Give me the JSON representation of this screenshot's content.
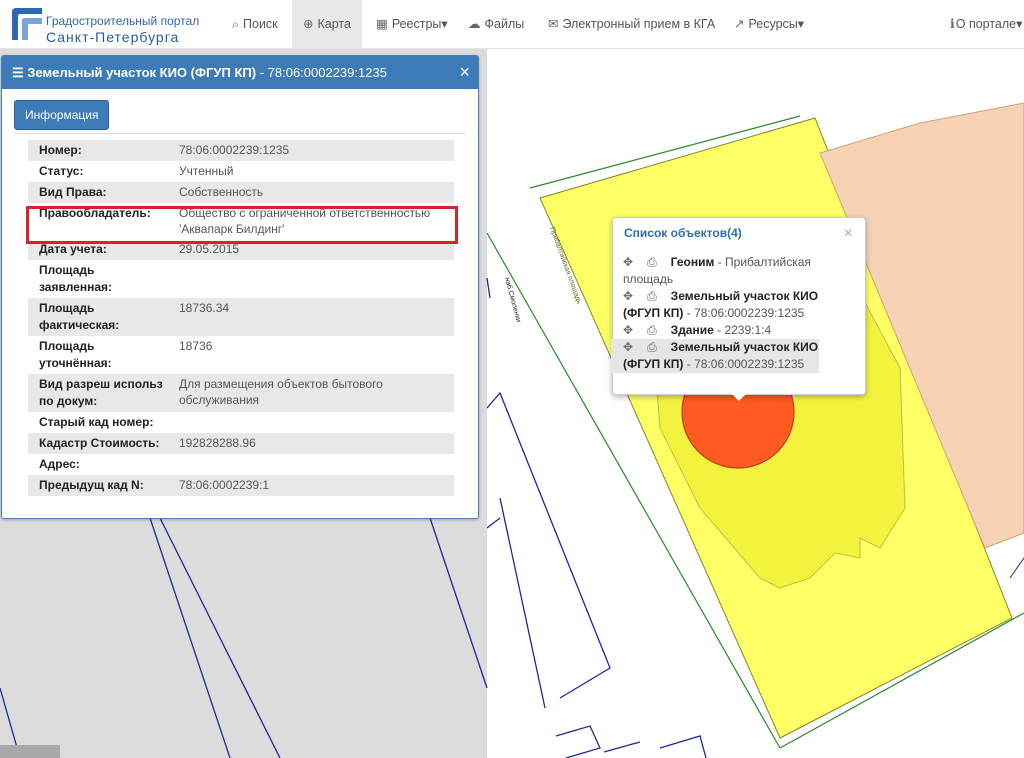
{
  "brand": {
    "line1": "Градостроительный портал",
    "line2": "Санкт-Петербурга"
  },
  "nav": [
    {
      "label": "Поиск",
      "icon": "search-icon",
      "glyph": "🔍"
    },
    {
      "label": "Карта",
      "icon": "globe-icon",
      "glyph": "🌐"
    },
    {
      "label": "Реестры▾",
      "icon": "table-icon",
      "glyph": "▦"
    },
    {
      "label": "Файлы",
      "icon": "cloud-icon",
      "glyph": "☁"
    },
    {
      "label": "Электронный прием в КГА",
      "icon": "chat-icon",
      "glyph": "💬"
    },
    {
      "label": "Ресурсы▾",
      "icon": "external-link-icon",
      "glyph": "↗"
    },
    {
      "label": "О портале▾",
      "icon": "info-icon",
      "glyph": "ℹ"
    }
  ],
  "panel": {
    "title": "Земельный участок КИО (ФГУП КП)",
    "title_sep": " - ",
    "title_id": "78:06:0002239:1235",
    "tab": "Информация",
    "rows": [
      {
        "label": "Номер:",
        "value": "78:06:0002239:1235"
      },
      {
        "label": "Статус:",
        "value": "Учтенный"
      },
      {
        "label": "Вид Права:",
        "value": "Собственность"
      },
      {
        "label": "Правообладатель:",
        "value": "Общество с ограниченной ответственностью 'Аквапарк Билдинг'"
      },
      {
        "label": "Дата учета:",
        "value": "29.05.2015"
      },
      {
        "label": "Площадь заявленная:",
        "value": ""
      },
      {
        "label": "Площадь фактическая:",
        "value": "18736.34"
      },
      {
        "label": "Площадь уточнённая:",
        "value": "18736"
      },
      {
        "label": "Вид разреш использ по докум:",
        "value": "Для размещения объектов бытового обслуживания"
      },
      {
        "label": "Старый кад номер:",
        "value": ""
      },
      {
        "label": "Кадастр Стоимость:",
        "value": "192828288.96"
      },
      {
        "label": "Адрес:",
        "value": ""
      },
      {
        "label": "Предыдущ кад N:",
        "value": "78:06:0002239:1"
      }
    ]
  },
  "popup": {
    "title": "Список объектов(4)",
    "items": [
      {
        "name": "Геоним",
        "detail": " - Прибалтийская площадь"
      },
      {
        "name": "Земельный участок КИО (ФГУП КП)",
        "detail": " - 78:06:0002239:1235"
      },
      {
        "name": "Здание",
        "detail": " - 2239:1:4"
      },
      {
        "name": "Земельный участок КИО (ФГУП КП)",
        "detail": " - 78:06:0002239:1235"
      }
    ]
  },
  "colors": {
    "header": "#3d7ab8",
    "highlight": "#d9222a",
    "parcel": "#ffff66",
    "marker": "#ff5a1f"
  }
}
